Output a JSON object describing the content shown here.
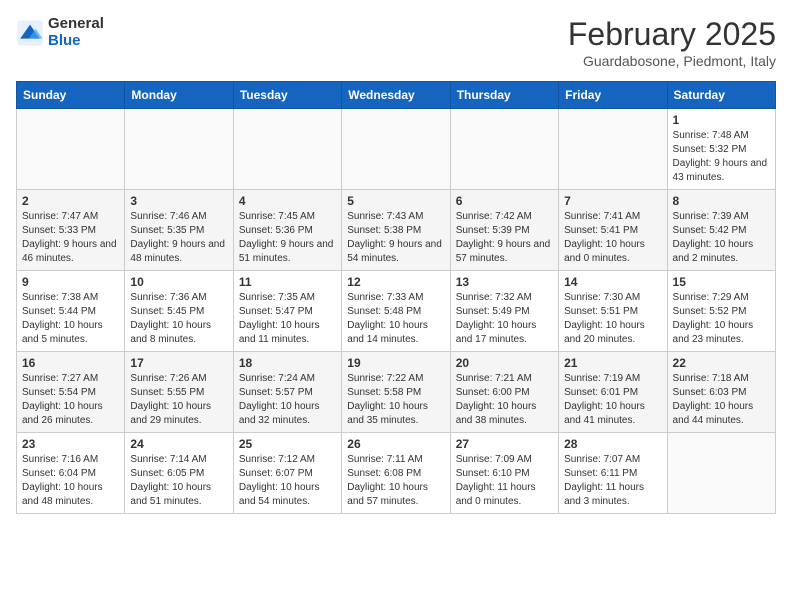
{
  "header": {
    "logo_general": "General",
    "logo_blue": "Blue",
    "month_title": "February 2025",
    "subtitle": "Guardabosone, Piedmont, Italy"
  },
  "weekdays": [
    "Sunday",
    "Monday",
    "Tuesday",
    "Wednesday",
    "Thursday",
    "Friday",
    "Saturday"
  ],
  "weeks": [
    [
      {
        "day": "",
        "info": ""
      },
      {
        "day": "",
        "info": ""
      },
      {
        "day": "",
        "info": ""
      },
      {
        "day": "",
        "info": ""
      },
      {
        "day": "",
        "info": ""
      },
      {
        "day": "",
        "info": ""
      },
      {
        "day": "1",
        "info": "Sunrise: 7:48 AM\nSunset: 5:32 PM\nDaylight: 9 hours and 43 minutes."
      }
    ],
    [
      {
        "day": "2",
        "info": "Sunrise: 7:47 AM\nSunset: 5:33 PM\nDaylight: 9 hours and 46 minutes."
      },
      {
        "day": "3",
        "info": "Sunrise: 7:46 AM\nSunset: 5:35 PM\nDaylight: 9 hours and 48 minutes."
      },
      {
        "day": "4",
        "info": "Sunrise: 7:45 AM\nSunset: 5:36 PM\nDaylight: 9 hours and 51 minutes."
      },
      {
        "day": "5",
        "info": "Sunrise: 7:43 AM\nSunset: 5:38 PM\nDaylight: 9 hours and 54 minutes."
      },
      {
        "day": "6",
        "info": "Sunrise: 7:42 AM\nSunset: 5:39 PM\nDaylight: 9 hours and 57 minutes."
      },
      {
        "day": "7",
        "info": "Sunrise: 7:41 AM\nSunset: 5:41 PM\nDaylight: 10 hours and 0 minutes."
      },
      {
        "day": "8",
        "info": "Sunrise: 7:39 AM\nSunset: 5:42 PM\nDaylight: 10 hours and 2 minutes."
      }
    ],
    [
      {
        "day": "9",
        "info": "Sunrise: 7:38 AM\nSunset: 5:44 PM\nDaylight: 10 hours and 5 minutes."
      },
      {
        "day": "10",
        "info": "Sunrise: 7:36 AM\nSunset: 5:45 PM\nDaylight: 10 hours and 8 minutes."
      },
      {
        "day": "11",
        "info": "Sunrise: 7:35 AM\nSunset: 5:47 PM\nDaylight: 10 hours and 11 minutes."
      },
      {
        "day": "12",
        "info": "Sunrise: 7:33 AM\nSunset: 5:48 PM\nDaylight: 10 hours and 14 minutes."
      },
      {
        "day": "13",
        "info": "Sunrise: 7:32 AM\nSunset: 5:49 PM\nDaylight: 10 hours and 17 minutes."
      },
      {
        "day": "14",
        "info": "Sunrise: 7:30 AM\nSunset: 5:51 PM\nDaylight: 10 hours and 20 minutes."
      },
      {
        "day": "15",
        "info": "Sunrise: 7:29 AM\nSunset: 5:52 PM\nDaylight: 10 hours and 23 minutes."
      }
    ],
    [
      {
        "day": "16",
        "info": "Sunrise: 7:27 AM\nSunset: 5:54 PM\nDaylight: 10 hours and 26 minutes."
      },
      {
        "day": "17",
        "info": "Sunrise: 7:26 AM\nSunset: 5:55 PM\nDaylight: 10 hours and 29 minutes."
      },
      {
        "day": "18",
        "info": "Sunrise: 7:24 AM\nSunset: 5:57 PM\nDaylight: 10 hours and 32 minutes."
      },
      {
        "day": "19",
        "info": "Sunrise: 7:22 AM\nSunset: 5:58 PM\nDaylight: 10 hours and 35 minutes."
      },
      {
        "day": "20",
        "info": "Sunrise: 7:21 AM\nSunset: 6:00 PM\nDaylight: 10 hours and 38 minutes."
      },
      {
        "day": "21",
        "info": "Sunrise: 7:19 AM\nSunset: 6:01 PM\nDaylight: 10 hours and 41 minutes."
      },
      {
        "day": "22",
        "info": "Sunrise: 7:18 AM\nSunset: 6:03 PM\nDaylight: 10 hours and 44 minutes."
      }
    ],
    [
      {
        "day": "23",
        "info": "Sunrise: 7:16 AM\nSunset: 6:04 PM\nDaylight: 10 hours and 48 minutes."
      },
      {
        "day": "24",
        "info": "Sunrise: 7:14 AM\nSunset: 6:05 PM\nDaylight: 10 hours and 51 minutes."
      },
      {
        "day": "25",
        "info": "Sunrise: 7:12 AM\nSunset: 6:07 PM\nDaylight: 10 hours and 54 minutes."
      },
      {
        "day": "26",
        "info": "Sunrise: 7:11 AM\nSunset: 6:08 PM\nDaylight: 10 hours and 57 minutes."
      },
      {
        "day": "27",
        "info": "Sunrise: 7:09 AM\nSunset: 6:10 PM\nDaylight: 11 hours and 0 minutes."
      },
      {
        "day": "28",
        "info": "Sunrise: 7:07 AM\nSunset: 6:11 PM\nDaylight: 11 hours and 3 minutes."
      },
      {
        "day": "",
        "info": ""
      }
    ]
  ]
}
